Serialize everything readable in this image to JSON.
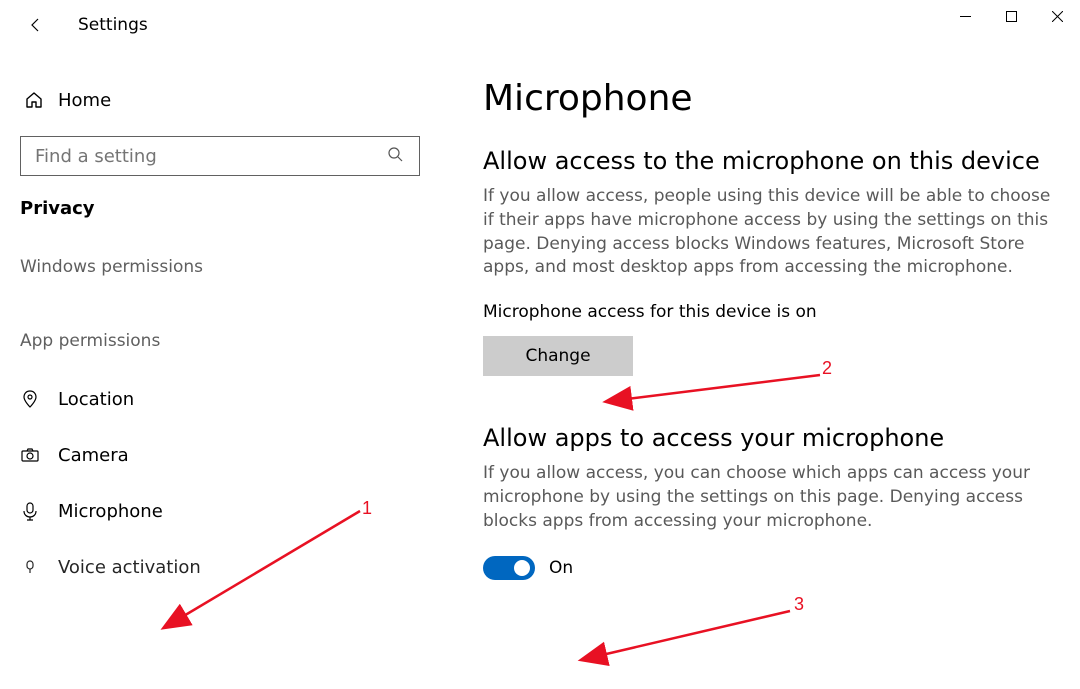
{
  "window": {
    "title": "Settings"
  },
  "sidebar": {
    "home": "Home",
    "search_placeholder": "Find a setting",
    "category": "Privacy",
    "group1": "Windows permissions",
    "group2": "App permissions",
    "items": {
      "location": "Location",
      "camera": "Camera",
      "microphone": "Microphone",
      "voice_activation": "Voice activation"
    }
  },
  "main": {
    "title": "Microphone",
    "section1": {
      "title": "Allow access to the microphone on this device",
      "body": "If you allow access, people using this device will be able to choose if their apps have microphone access by using the settings on this page. Denying access blocks Windows features, Microsoft Store apps, and most desktop apps from accessing the microphone.",
      "status": "Microphone access for this device is on",
      "change_btn": "Change"
    },
    "section2": {
      "title": "Allow apps to access your microphone",
      "body": "If you allow access, you can choose which apps can access your microphone by using the settings on this page. Denying access blocks apps from accessing your microphone.",
      "toggle_label": "On"
    }
  },
  "annotations": {
    "a1": "1",
    "a2": "2",
    "a3": "3"
  }
}
